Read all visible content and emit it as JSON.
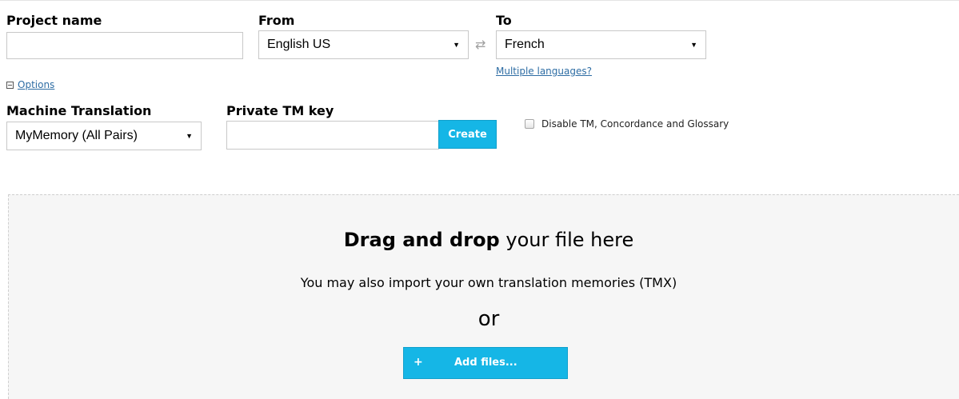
{
  "form": {
    "project_name": {
      "label": "Project name",
      "value": ""
    },
    "from": {
      "label": "From",
      "selected": "English US"
    },
    "to": {
      "label": "To",
      "selected": "French",
      "multiple_link": "Multiple languages?"
    },
    "options_link": "Options",
    "machine_translation": {
      "label": "Machine Translation",
      "selected": "MyMemory (All Pairs)"
    },
    "private_tm": {
      "label": "Private TM key",
      "value": "",
      "create_button": "Create"
    },
    "disable_tm": {
      "label": "Disable TM, Concordance and Glossary",
      "checked": false
    }
  },
  "dropzone": {
    "title_bold": "Drag and drop",
    "title_rest": " your file here",
    "subtitle": "You may also import your own translation memories (TMX)",
    "or": "or",
    "add_button": {
      "icon": "+",
      "label": "Add files..."
    }
  },
  "colors": {
    "accent": "#15b6e6",
    "link": "#2e6da4",
    "dropzone_bg": "#f6f6f6"
  },
  "icons": {
    "swap": "swap-arrows-icon",
    "caret": "caret-down-icon",
    "options_toggle": "collapse-box-icon"
  }
}
